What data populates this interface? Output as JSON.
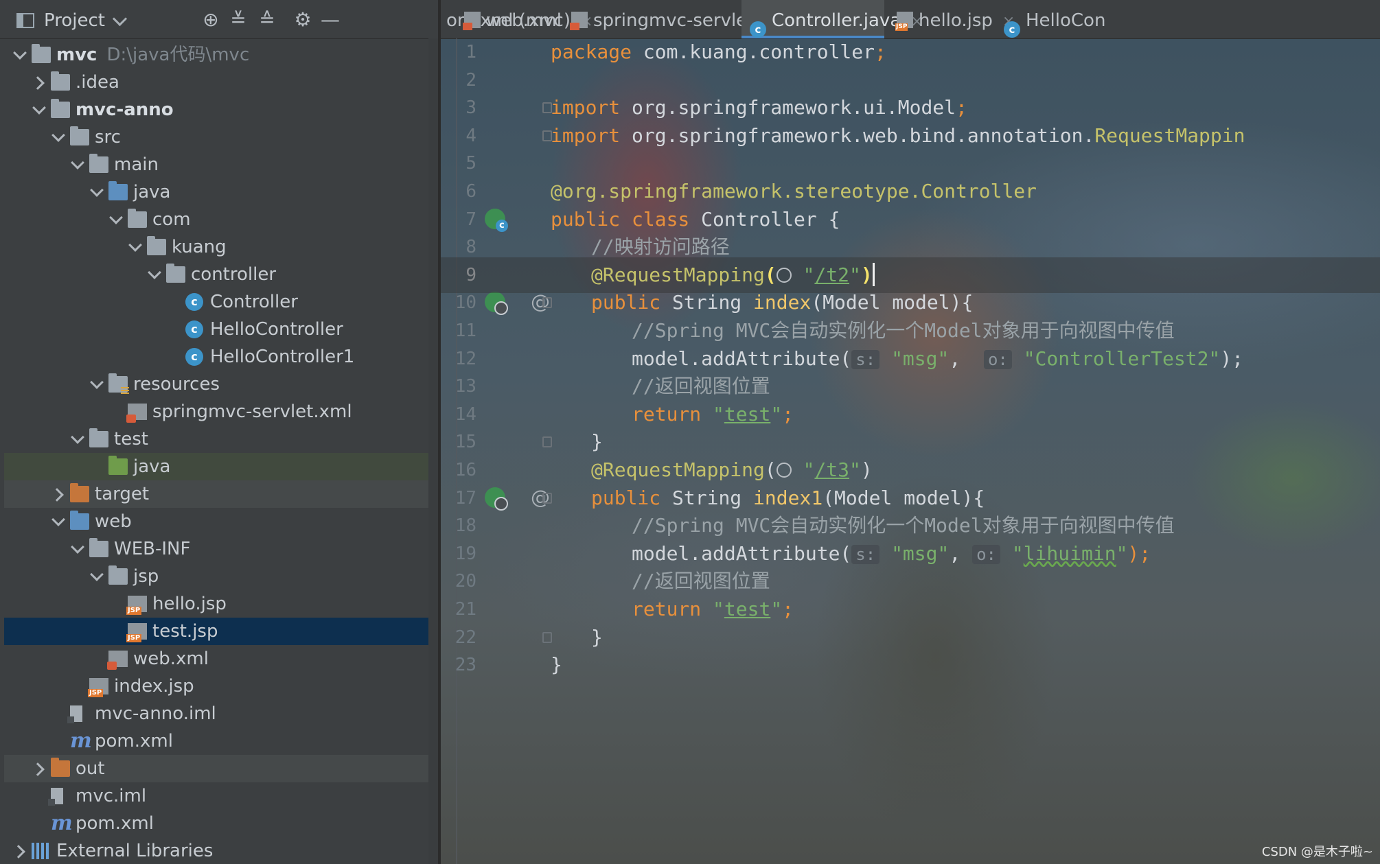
{
  "project_panel": {
    "title": "Project",
    "tools": [
      "locate-icon",
      "expand-all-icon",
      "collapse-all-icon",
      "gear-icon",
      "hide-icon"
    ]
  },
  "tree": [
    {
      "label": "mvc",
      "path": "D:\\java代码\\mvc",
      "depth": 0,
      "arrow": "open",
      "icon": "module-folder-icon",
      "bold": true
    },
    {
      "label": ".idea",
      "depth": 1,
      "arrow": "closed",
      "icon": "folder-icon"
    },
    {
      "label": "mvc-anno",
      "depth": 1,
      "arrow": "open",
      "icon": "module-folder-icon",
      "bold": true
    },
    {
      "label": "src",
      "depth": 2,
      "arrow": "open",
      "icon": "folder-icon"
    },
    {
      "label": "main",
      "depth": 3,
      "arrow": "open",
      "icon": "folder-icon"
    },
    {
      "label": "java",
      "depth": 4,
      "arrow": "open",
      "icon": "source-folder-icon"
    },
    {
      "label": "com",
      "depth": 5,
      "arrow": "open",
      "icon": "package-icon"
    },
    {
      "label": "kuang",
      "depth": 6,
      "arrow": "open",
      "icon": "package-icon"
    },
    {
      "label": "controller",
      "depth": 7,
      "arrow": "open",
      "icon": "package-icon"
    },
    {
      "label": "Controller",
      "depth": 8,
      "icon": "java-class-icon"
    },
    {
      "label": "HelloController",
      "depth": 8,
      "icon": "java-class-icon"
    },
    {
      "label": "HelloController1",
      "depth": 8,
      "icon": "java-class-icon"
    },
    {
      "label": "resources",
      "depth": 4,
      "arrow": "open",
      "icon": "resources-folder-icon"
    },
    {
      "label": "springmvc-servlet.xml",
      "depth": 5,
      "icon": "xml-file-icon"
    },
    {
      "label": "test",
      "depth": 3,
      "arrow": "open",
      "icon": "folder-icon"
    },
    {
      "label": "java",
      "depth": 4,
      "icon": "test-source-folder-icon",
      "highlight": "green"
    },
    {
      "label": "target",
      "depth": 2,
      "arrow": "closed",
      "icon": "excluded-folder-icon",
      "highlight": "gray"
    },
    {
      "label": "web",
      "depth": 2,
      "arrow": "open",
      "icon": "web-folder-icon"
    },
    {
      "label": "WEB-INF",
      "depth": 3,
      "arrow": "open",
      "icon": "folder-icon"
    },
    {
      "label": "jsp",
      "depth": 4,
      "arrow": "open",
      "icon": "folder-icon"
    },
    {
      "label": "hello.jsp",
      "depth": 5,
      "icon": "jsp-file-icon"
    },
    {
      "label": "test.jsp",
      "depth": 5,
      "icon": "jsp-file-icon",
      "selected": true
    },
    {
      "label": "web.xml",
      "depth": 4,
      "icon": "xml-file-icon"
    },
    {
      "label": "index.jsp",
      "depth": 3,
      "icon": "jsp-file-icon"
    },
    {
      "label": "mvc-anno.iml",
      "depth": 2,
      "icon": "iml-file-icon"
    },
    {
      "label": "pom.xml",
      "depth": 2,
      "icon": "maven-icon"
    },
    {
      "label": "out",
      "depth": 1,
      "arrow": "closed",
      "icon": "excluded-folder-icon",
      "highlight": "gray"
    },
    {
      "label": "mvc.iml",
      "depth": 1,
      "icon": "iml-file-icon"
    },
    {
      "label": "pom.xml",
      "depth": 1,
      "icon": "maven-icon"
    },
    {
      "label": "External Libraries",
      "depth": 0,
      "arrow": "closed",
      "icon": "library-icon"
    }
  ],
  "tabs": [
    {
      "label": "om.xml (mvc)",
      "icon": "",
      "active": false
    },
    {
      "label": "web.xml",
      "icon": "xml",
      "active": false
    },
    {
      "label": "springmvc-servlet.xml",
      "icon": "xml",
      "active": false
    },
    {
      "label": "Controller.java",
      "icon": "cls",
      "active": true
    },
    {
      "label": "hello.jsp",
      "icon": "jsp",
      "active": false
    },
    {
      "label": "HelloCon",
      "icon": "cls",
      "active": false
    }
  ],
  "editor": {
    "current_line": 9,
    "lines": [
      {
        "n": 1,
        "indent": 0,
        "tokens": [
          [
            "kw",
            "package "
          ],
          [
            "t",
            "com.kuang.controller"
          ],
          [
            "kw",
            ";"
          ]
        ]
      },
      {
        "n": 2,
        "indent": 0,
        "tokens": []
      },
      {
        "n": 3,
        "indent": 0,
        "tokens": [
          [
            "kw",
            "import "
          ],
          [
            "t",
            "org.springframework.ui.Model"
          ],
          [
            "kw",
            ";"
          ]
        ]
      },
      {
        "n": 4,
        "indent": 0,
        "tokens": [
          [
            "kw",
            "import "
          ],
          [
            "t",
            "org.springframework.web.bind.annotation."
          ],
          [
            "ann",
            "RequestMappin"
          ]
        ]
      },
      {
        "n": 5,
        "indent": 0,
        "tokens": []
      },
      {
        "n": 6,
        "indent": 0,
        "tokens": [
          [
            "ann",
            "@org.springframework.stereotype."
          ],
          [
            "ann",
            "Controller"
          ]
        ]
      },
      {
        "n": 7,
        "indent": 0,
        "tokens": [
          [
            "kw",
            "public class "
          ],
          [
            "t",
            "Controller {"
          ]
        ]
      },
      {
        "n": 8,
        "indent": 1,
        "tokens": [
          [
            "cmt",
            "//映射访问路径"
          ]
        ]
      },
      {
        "n": 9,
        "indent": 1,
        "tokens": [
          [
            "ann",
            "@RequestMapping"
          ],
          [
            "br",
            "("
          ],
          [
            "globe",
            ""
          ],
          [
            "t",
            " "
          ],
          [
            "str",
            "\""
          ],
          [
            "strl",
            "/t2"
          ],
          [
            "str",
            "\""
          ],
          [
            "br",
            ")"
          ],
          [
            "caret",
            ""
          ]
        ]
      },
      {
        "n": 10,
        "indent": 1,
        "tokens": [
          [
            "kw",
            "public "
          ],
          [
            "t",
            "String "
          ],
          [
            "fn",
            "index"
          ],
          [
            "t",
            "(Model model){"
          ]
        ]
      },
      {
        "n": 11,
        "indent": 2,
        "tokens": [
          [
            "cmt",
            "//Spring MVC会自动实例化一个Model对象用于向视图中传值"
          ]
        ]
      },
      {
        "n": 12,
        "indent": 2,
        "tokens": [
          [
            "t",
            "model.addAttribute("
          ],
          [
            "hint",
            "s:"
          ],
          [
            "t",
            " "
          ],
          [
            "str",
            "\"msg\""
          ],
          [
            "t",
            ",  "
          ],
          [
            "hint",
            "o:"
          ],
          [
            "t",
            " "
          ],
          [
            "str",
            "\"ControllerTest2\""
          ],
          [
            "t",
            ");"
          ]
        ]
      },
      {
        "n": 13,
        "indent": 2,
        "tokens": [
          [
            "cmt",
            "//返回视图位置"
          ]
        ]
      },
      {
        "n": 14,
        "indent": 2,
        "tokens": [
          [
            "kw",
            "return "
          ],
          [
            "str",
            "\""
          ],
          [
            "strl",
            "test"
          ],
          [
            "str",
            "\""
          ],
          [
            "kw",
            ";"
          ]
        ]
      },
      {
        "n": 15,
        "indent": 1,
        "tokens": [
          [
            "t",
            "}"
          ]
        ]
      },
      {
        "n": 16,
        "indent": 1,
        "tokens": [
          [
            "ann",
            "@RequestMapping"
          ],
          [
            "t",
            "("
          ],
          [
            "globe",
            ""
          ],
          [
            "t",
            " "
          ],
          [
            "str",
            "\""
          ],
          [
            "strl",
            "/t3"
          ],
          [
            "str",
            "\""
          ],
          [
            "t",
            ")"
          ]
        ]
      },
      {
        "n": 17,
        "indent": 1,
        "tokens": [
          [
            "kw",
            "public "
          ],
          [
            "t",
            "String "
          ],
          [
            "fn",
            "index1"
          ],
          [
            "t",
            "(Model model){"
          ]
        ]
      },
      {
        "n": 18,
        "indent": 2,
        "tokens": [
          [
            "cmt",
            "//Spring MVC会自动实例化一个Model对象用于向视图中传值"
          ]
        ]
      },
      {
        "n": 19,
        "indent": 2,
        "tokens": [
          [
            "t",
            "model.addAttribute("
          ],
          [
            "hint",
            "s:"
          ],
          [
            "t",
            " "
          ],
          [
            "str",
            "\"msg\""
          ],
          [
            "t",
            ", "
          ],
          [
            "hint",
            "o:"
          ],
          [
            "t",
            " "
          ],
          [
            "str",
            "\""
          ],
          [
            "sq",
            "lihuimin"
          ],
          [
            "str",
            "\""
          ],
          [
            "kw",
            ");"
          ]
        ]
      },
      {
        "n": 20,
        "indent": 2,
        "tokens": [
          [
            "cmt",
            "//返回视图位置"
          ]
        ]
      },
      {
        "n": 21,
        "indent": 2,
        "tokens": [
          [
            "kw",
            "return "
          ],
          [
            "str",
            "\""
          ],
          [
            "strl",
            "test"
          ],
          [
            "str",
            "\""
          ],
          [
            "kw",
            ";"
          ]
        ]
      },
      {
        "n": 22,
        "indent": 1,
        "tokens": [
          [
            "t",
            "}"
          ]
        ]
      },
      {
        "n": 23,
        "indent": 0,
        "tokens": [
          [
            "t",
            "}"
          ]
        ]
      }
    ],
    "gutter_icons": [
      {
        "line": 7,
        "kind": "bean",
        "name": "spring-bean-icon"
      },
      {
        "line": 10,
        "kind": "web",
        "name": "request-mapping-icon"
      },
      {
        "line": 10,
        "kind": "at",
        "name": "at-annotation-icon"
      },
      {
        "line": 17,
        "kind": "web",
        "name": "request-mapping-icon"
      },
      {
        "line": 17,
        "kind": "at",
        "name": "at-annotation-icon"
      }
    ],
    "fold_marks": [
      3,
      4,
      10,
      15,
      17,
      22
    ]
  },
  "watermark": "CSDN @是木子啦~",
  "colors": {
    "accent": "#4a88c7",
    "selection": "#0d2f4f",
    "keyword": "#e8903c",
    "annotation": "#c5c26a",
    "string": "#79b06b"
  }
}
